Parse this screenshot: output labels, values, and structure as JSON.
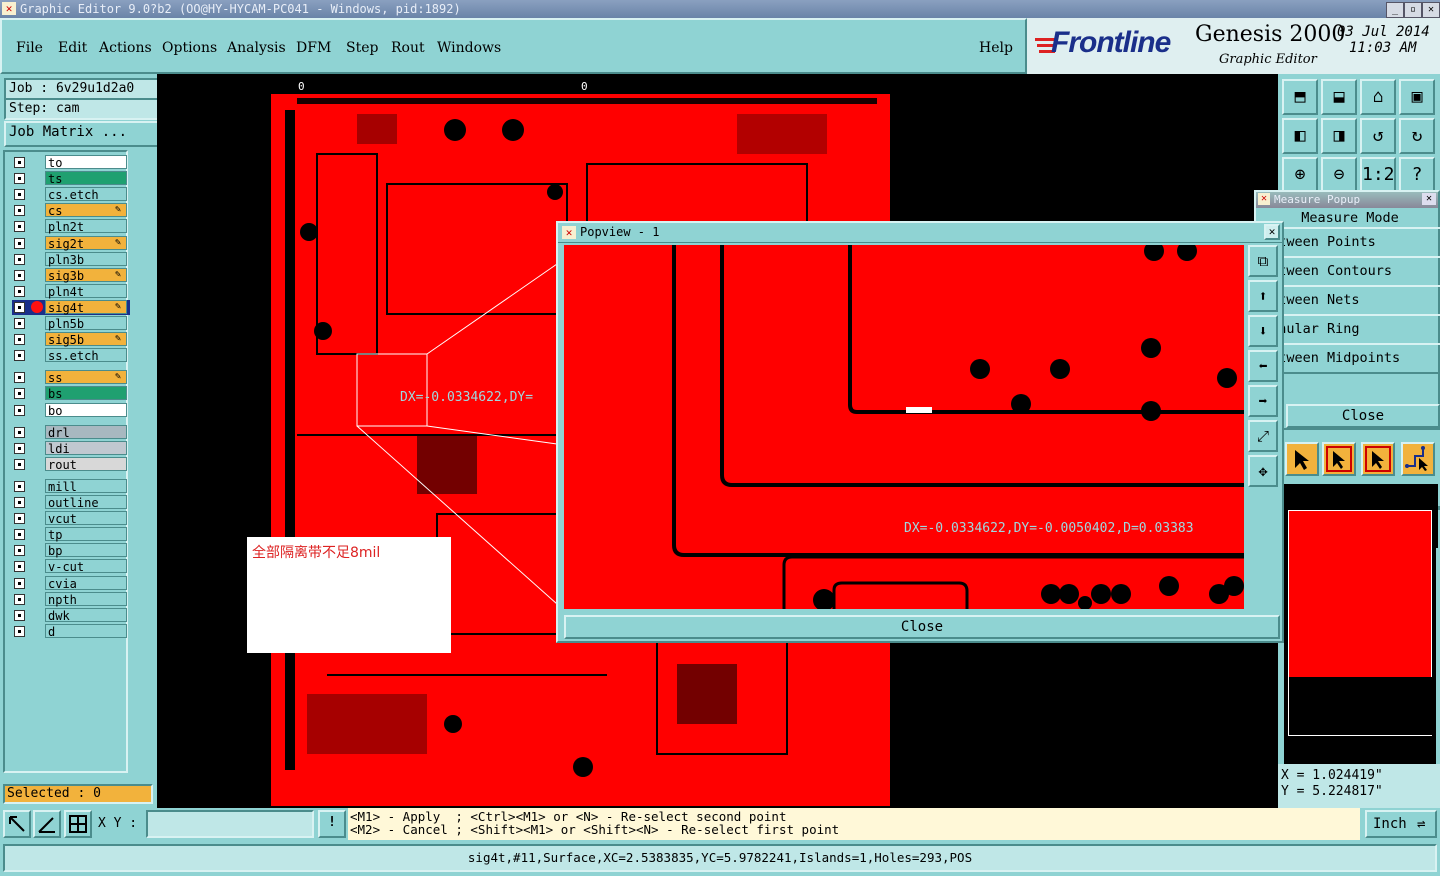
{
  "window": {
    "title": "Graphic Editor 9.0?b2 (OO@HY-HYCAM-PC041 - Windows, pid:1892)",
    "icon": "x-app-icon"
  },
  "menu": {
    "items": [
      "File",
      "Edit",
      "Actions",
      "Options",
      "Analysis",
      "DFM",
      "Step",
      "Rout",
      "Windows"
    ],
    "help": "Help"
  },
  "brand": {
    "logo": "Frontline",
    "product": "Genesis 2000",
    "subtitle": "Graphic Editor",
    "date": "03 Jul 2014",
    "time": "11:03 AM"
  },
  "job": {
    "job_label": "Job  :  6v29u1d2a0",
    "step_label": "Step:  cam",
    "matrix_button": "Job Matrix ..."
  },
  "layers": [
    {
      "name": "to",
      "color": "#ffffff"
    },
    {
      "name": "ts",
      "color": "#1fa070"
    },
    {
      "name": "cs.etch",
      "color": "#8fd3d3"
    },
    {
      "name": "cs",
      "color": "#f2b23c",
      "marker": "pencil"
    },
    {
      "name": "pln2t",
      "color": "#8fd3d3"
    },
    {
      "name": "sig2t",
      "color": "#f2b23c",
      "marker": "pencil"
    },
    {
      "name": "pln3b",
      "color": "#8fd3d3"
    },
    {
      "name": "sig3b",
      "color": "#f2b23c",
      "marker": "pencil"
    },
    {
      "name": "pln4t",
      "color": "#8fd3d3"
    },
    {
      "name": "sig4t",
      "color": "#f2b23c",
      "marker": "pencil",
      "active": true
    },
    {
      "name": "pln5b",
      "color": "#8fd3d3"
    },
    {
      "name": "sig5b",
      "color": "#f2b23c",
      "marker": "pencil"
    },
    {
      "name": "ss.etch",
      "color": "#8fd3d3"
    },
    {
      "name": "ss",
      "color": "#f2b23c",
      "marker": "pencil"
    },
    {
      "name": "bs",
      "color": "#1fa070"
    },
    {
      "name": "bo",
      "color": "#ffffff"
    },
    {
      "name": "drl",
      "color": "#a8b8c0"
    },
    {
      "name": "ldi",
      "color": "#c0c8d0"
    },
    {
      "name": "rout",
      "color": "#d8d8d8"
    },
    {
      "name": "mill",
      "color": "#8fd3d3"
    },
    {
      "name": "outline",
      "color": "#8fd3d3"
    },
    {
      "name": "vcut",
      "color": "#8fd3d3"
    },
    {
      "name": "tp",
      "color": "#8fd3d3"
    },
    {
      "name": "bp",
      "color": "#8fd3d3"
    },
    {
      "name": "v-cut",
      "color": "#8fd3d3"
    },
    {
      "name": "cvia",
      "color": "#8fd3d3"
    },
    {
      "name": "npth",
      "color": "#8fd3d3"
    },
    {
      "name": "dwk",
      "color": "#8fd3d3"
    },
    {
      "name": "d",
      "color": "#8fd3d3"
    }
  ],
  "selected_label": "Selected : 0",
  "canvas": {
    "ruler_left": "0",
    "ruler_right": "0",
    "measure_text": "DX=-0.0334622,DY=",
    "note": "全部隔离带不足8mil",
    "board_color": "#ff0000"
  },
  "popview": {
    "title": "Popview - 1",
    "measure_text": "DX=-0.0334622,DY=-0.0050402,D=0.03383",
    "close_button": "Close"
  },
  "measure_popup": {
    "title": "Measure Popup",
    "heading": "Measure Mode",
    "modes": [
      "Between Points",
      "Between Contours",
      "Between Nets",
      "Annular Ring",
      "Between Midpoints"
    ],
    "close_button": "Close"
  },
  "coords": {
    "x": "X  =  1.024419\"",
    "y": "Y  =  5.224817\""
  },
  "command": {
    "xy_label": "X Y :",
    "xy_value": "",
    "hint1": "<M1> - Apply  ; <Ctrl><M1> or <N> - Re-select second point",
    "hint2": "<M2> - Cancel ; <Shift><M1> or <Shift><N> - Re-select first point",
    "units": "Inch"
  },
  "status": "sig4t,#11,Surface,XC=2.5383835,YC=5.9782241,Islands=1,Holes=293,POS"
}
